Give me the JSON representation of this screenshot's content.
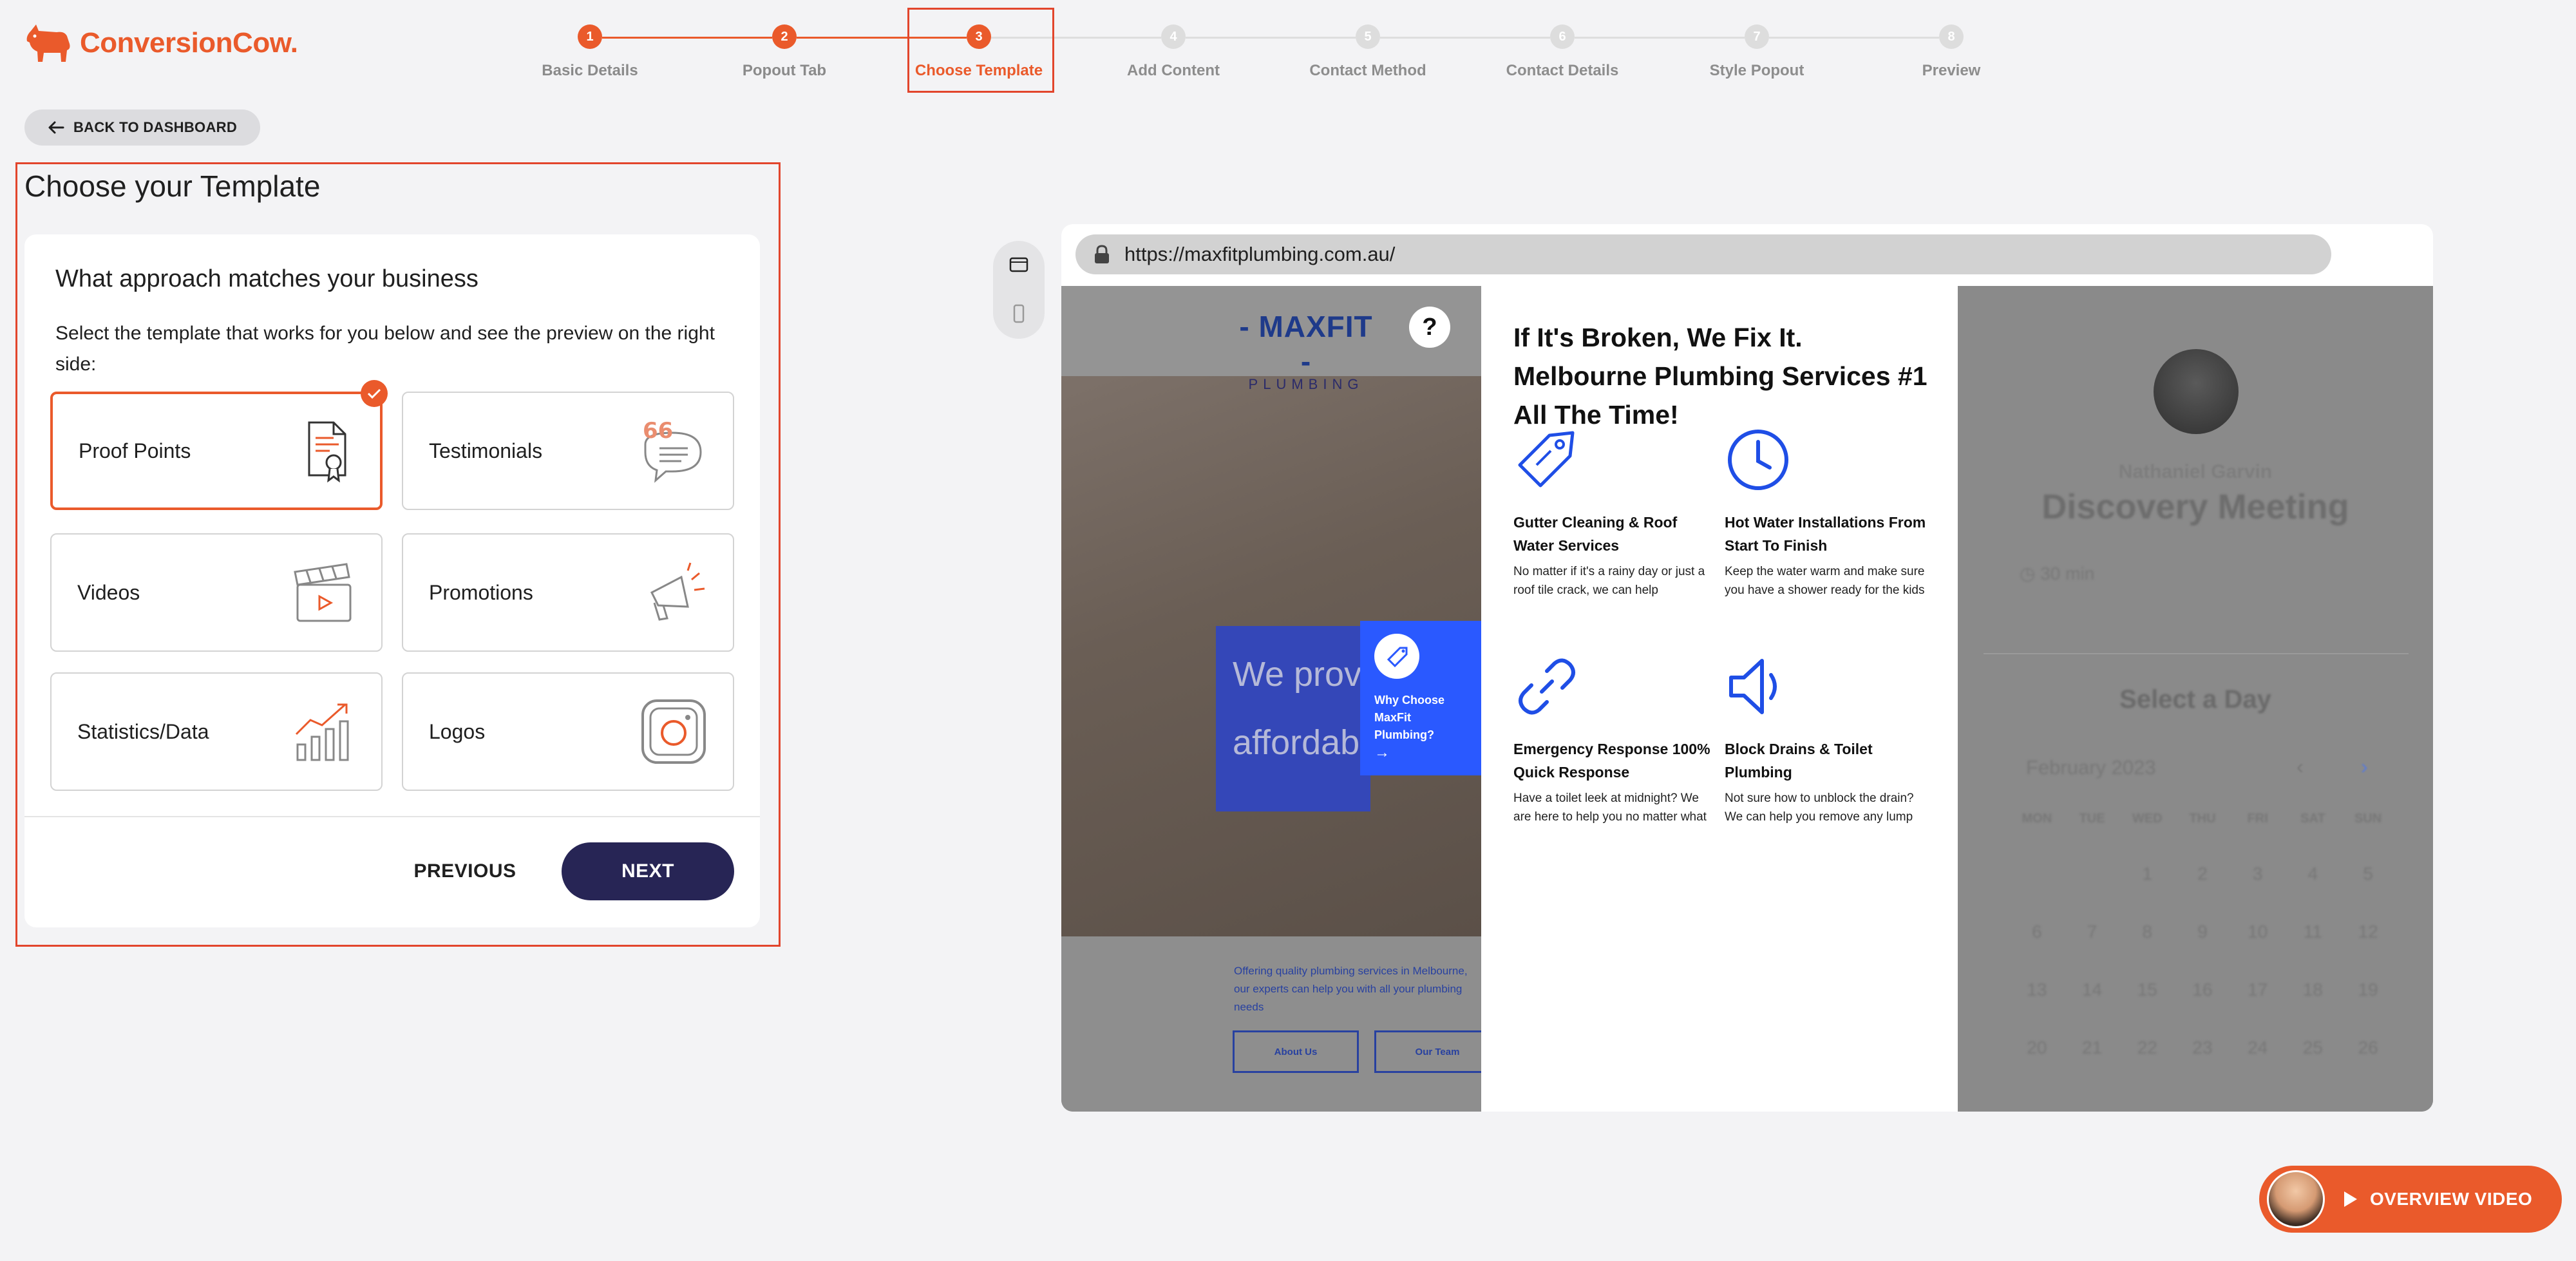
{
  "brand": {
    "name": "ConversionCow.",
    "color": "#ea5a2b"
  },
  "steps": [
    {
      "num": "1",
      "label": "Basic Details",
      "state": "done"
    },
    {
      "num": "2",
      "label": "Popout Tab",
      "state": "done"
    },
    {
      "num": "3",
      "label": "Choose Template",
      "state": "active"
    },
    {
      "num": "4",
      "label": "Add Content",
      "state": "pending"
    },
    {
      "num": "5",
      "label": "Contact Method",
      "state": "pending"
    },
    {
      "num": "6",
      "label": "Contact Details",
      "state": "pending"
    },
    {
      "num": "7",
      "label": "Style Popout",
      "state": "pending"
    },
    {
      "num": "8",
      "label": "Preview",
      "state": "pending"
    }
  ],
  "back_label": "BACK TO DASHBOARD",
  "main": {
    "heading": "Choose your Template",
    "approach": "What approach matches your business",
    "description": "Select the template that works for you below and see the preview on the right side:",
    "templates": [
      {
        "label": "Proof Points",
        "icon": "certificate-icon",
        "selected": true
      },
      {
        "label": "Testimonials",
        "icon": "speech-bubble-icon",
        "selected": false
      },
      {
        "label": "Videos",
        "icon": "clapperboard-icon",
        "selected": false
      },
      {
        "label": "Promotions",
        "icon": "megaphone-icon",
        "selected": false
      },
      {
        "label": "Statistics/Data",
        "icon": "bar-chart-icon",
        "selected": false
      },
      {
        "label": "Logos",
        "icon": "instagram-logo-icon",
        "selected": false
      }
    ],
    "prev_label": "PREVIOUS",
    "next_label": "NEXT"
  },
  "preview": {
    "url": "https://maxfitplumbing.com.au/",
    "site": {
      "logo_main": "- MAXFIT -",
      "logo_sub": "PLUMBING",
      "help": "?",
      "hero_line1": "We prov",
      "hero_line2": "affordab",
      "why_text": "Why Choose MaxFit Plumbing?",
      "why_arrow": "→",
      "offer": "Offering quality plumbing services in Melbourne, our experts can help you with all your plumbing needs",
      "btn_about": "About Us",
      "btn_team": "Our Team"
    },
    "popout": {
      "title": "If It's Broken, We Fix It. Melbourne Plumbing Services #1 All The Time!",
      "features": [
        {
          "title": "Gutter Cleaning & Roof Water Services",
          "desc": "No matter if it's a rainy day or just a roof tile crack, we can help",
          "icon": "tag-icon"
        },
        {
          "title": "Hot Water Installations From Start To Finish",
          "desc": "Keep the water warm and make sure you have a shower ready for the kids",
          "icon": "clock-icon"
        },
        {
          "title": "Emergency Response 100% Quick Response",
          "desc": "Have a toilet leek at midnight? We are here to help you no matter what",
          "icon": "link-icon"
        },
        {
          "title": "Block Drains & Toilet Plumbing",
          "desc": "Not sure how to unblock the drain? We can help you remove any lump",
          "icon": "speaker-icon"
        }
      ]
    },
    "booking": {
      "name": "Nathaniel Garvin",
      "title": "Discovery Meeting",
      "duration": "30 min",
      "select": "Select a Day",
      "month": "February 2023",
      "days": [
        "MON",
        "TUE",
        "WED",
        "THU",
        "FRI",
        "SAT",
        "SUN"
      ],
      "dates": [
        "",
        "",
        "1",
        "2",
        "3",
        "4",
        "5",
        "6",
        "7",
        "8",
        "9",
        "10",
        "11",
        "12",
        "13",
        "14",
        "15",
        "16",
        "17",
        "18",
        "19",
        "20",
        "21",
        "22",
        "23",
        "24",
        "25",
        "26"
      ]
    }
  },
  "overview_label": "OVERVIEW VIDEO"
}
